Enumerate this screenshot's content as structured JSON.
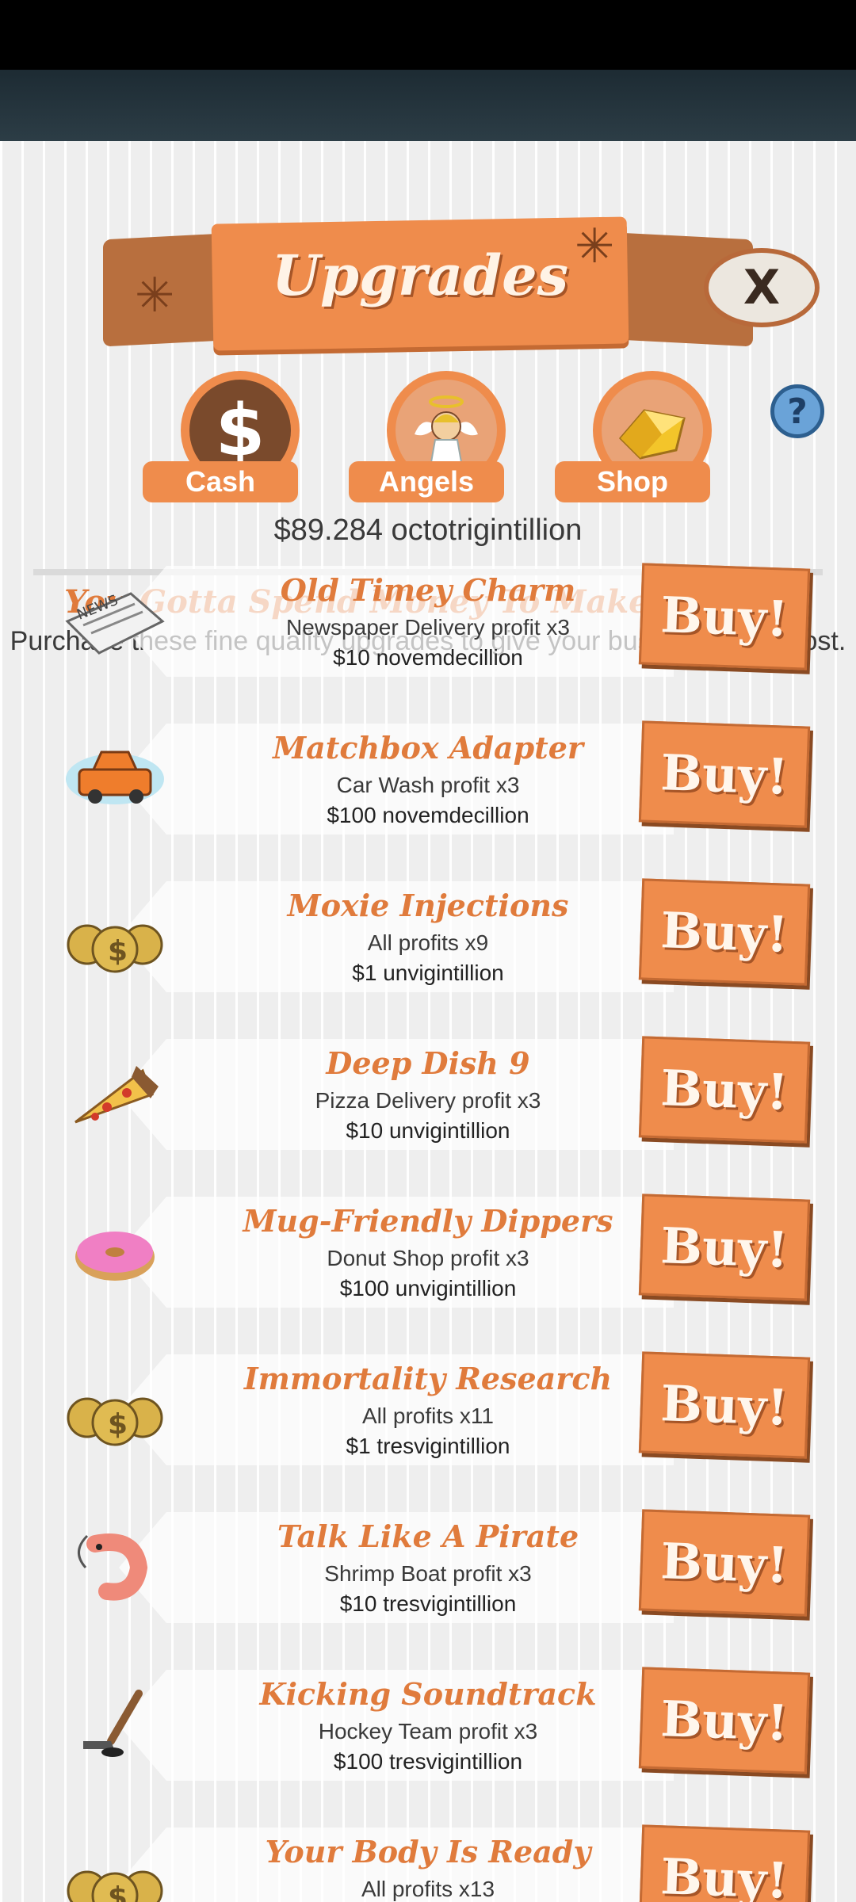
{
  "header": {
    "title": "Upgrades",
    "close_label": "X",
    "help_label": "?"
  },
  "tabs": [
    {
      "label": "Cash",
      "icon": "dollar-icon"
    },
    {
      "label": "Angels",
      "icon": "angel-icon"
    },
    {
      "label": "Shop",
      "icon": "gold-icon"
    }
  ],
  "balance": "$89.284 octotrigintillion",
  "headline": "You Gotta Spend Money To Make Money!",
  "subline": "Purchase these fine quality upgrades to give your businesses a boost.",
  "buy_label": "Buy!",
  "upgrades": [
    {
      "name": "Old Timey Charm",
      "effect": "Newspaper Delivery profit x3",
      "price": "$10 novemdecillion",
      "icon": "newspaper-icon"
    },
    {
      "name": "Matchbox Adapter",
      "effect": "Car Wash profit x3",
      "price": "$100 novemdecillion",
      "icon": "car-icon"
    },
    {
      "name": "Moxie Injections",
      "effect": "All profits x9",
      "price": "$1 unvigintillion",
      "icon": "money-bags-icon"
    },
    {
      "name": "Deep Dish 9",
      "effect": "Pizza Delivery profit x3",
      "price": "$10 unvigintillion",
      "icon": "pizza-icon"
    },
    {
      "name": "Mug-Friendly Dippers",
      "effect": "Donut Shop profit x3",
      "price": "$100 unvigintillion",
      "icon": "donut-icon"
    },
    {
      "name": "Immortality Research",
      "effect": "All profits x11",
      "price": "$1 tresvigintillion",
      "icon": "money-bags-icon"
    },
    {
      "name": "Talk Like A Pirate",
      "effect": "Shrimp Boat profit x3",
      "price": "$10 tresvigintillion",
      "icon": "shrimp-icon"
    },
    {
      "name": "Kicking Soundtrack",
      "effect": "Hockey Team profit x3",
      "price": "$100 tresvigintillion",
      "icon": "hockey-stick-icon"
    },
    {
      "name": "Your Body Is Ready",
      "effect": "All profits x13",
      "price": "",
      "icon": "money-bags-icon"
    }
  ]
}
